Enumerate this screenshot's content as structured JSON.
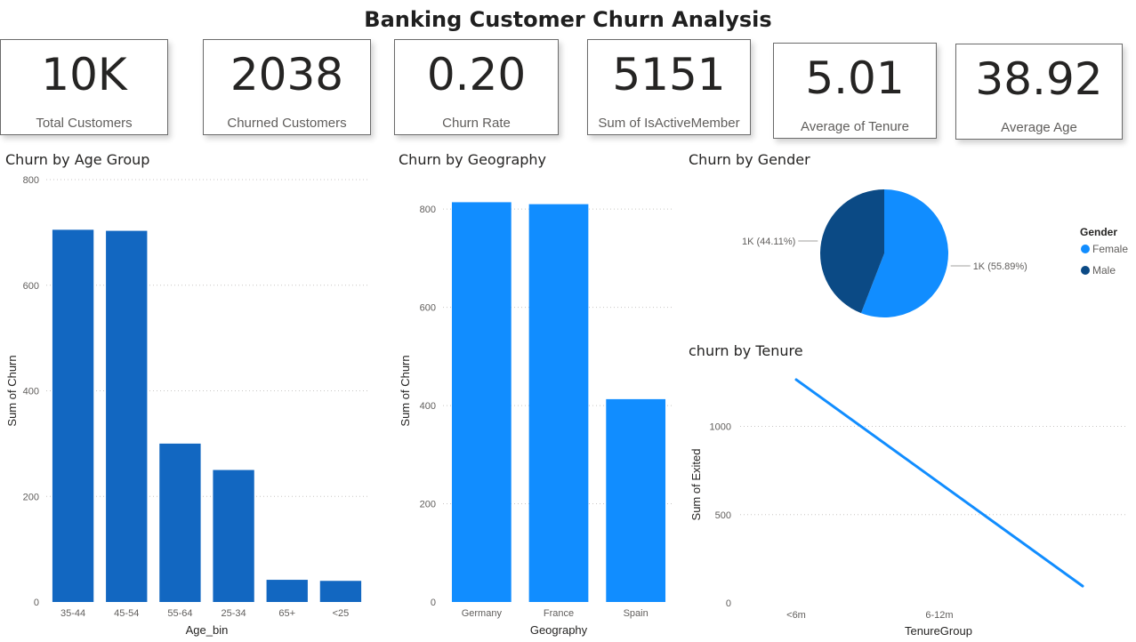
{
  "title": "Banking Customer Churn Analysis",
  "kpis": [
    {
      "value": "10K",
      "label": "Total Customers"
    },
    {
      "value": "2038",
      "label": "Churned Customers"
    },
    {
      "value": "0.20",
      "label": "Churn Rate"
    },
    {
      "value": "5151",
      "label": "Sum of IsActiveMember"
    },
    {
      "value": "5.01",
      "label": "Average of Tenure"
    },
    {
      "value": "38.92",
      "label": "Average Age"
    }
  ],
  "colors": {
    "age_bar": "#1267c1",
    "geo_bar": "#118dff",
    "female": "#118dff",
    "male": "#0b4a85",
    "line": "#118dff",
    "grid": "#c8c6c4",
    "axis_text": "#605e5c"
  },
  "chart_data": [
    {
      "id": "age",
      "type": "bar",
      "title": "Churn by Age Group",
      "xlabel": "Age_bin",
      "ylabel": "Sum of Churn",
      "categories": [
        "35-44",
        "45-54",
        "55-64",
        "25-34",
        "65+",
        "<25"
      ],
      "values": [
        705,
        703,
        300,
        250,
        42,
        40
      ],
      "ylim": [
        0,
        800
      ],
      "yticks": [
        0,
        200,
        400,
        600,
        800
      ],
      "grid": true
    },
    {
      "id": "geo",
      "type": "bar",
      "title": "Churn by Geography",
      "xlabel": "Geography",
      "ylabel": "Sum of Churn",
      "categories": [
        "Germany",
        "France",
        "Spain"
      ],
      "values": [
        814,
        810,
        413
      ],
      "ylim": [
        0,
        860
      ],
      "yticks": [
        0,
        200,
        400,
        600,
        800
      ],
      "grid": true
    },
    {
      "id": "gender",
      "type": "pie",
      "title": "Churn by Gender",
      "legend_title": "Gender",
      "legend_position": "right",
      "labels": [
        "Female",
        "Male"
      ],
      "values": [
        55.89,
        44.11
      ],
      "data_labels": [
        "1K (55.89%)",
        "1K (44.11%)"
      ]
    },
    {
      "id": "tenure",
      "type": "line",
      "title": "churn by Tenure",
      "xlabel": "TenureGroup",
      "ylabel": "Sum of Exited",
      "categories": [
        "<6m",
        "6-12m",
        ""
      ],
      "values": [
        1265,
        680,
        95
      ],
      "ylim": [
        0,
        1300
      ],
      "yticks": [
        0,
        500,
        1000
      ],
      "grid": true
    }
  ]
}
